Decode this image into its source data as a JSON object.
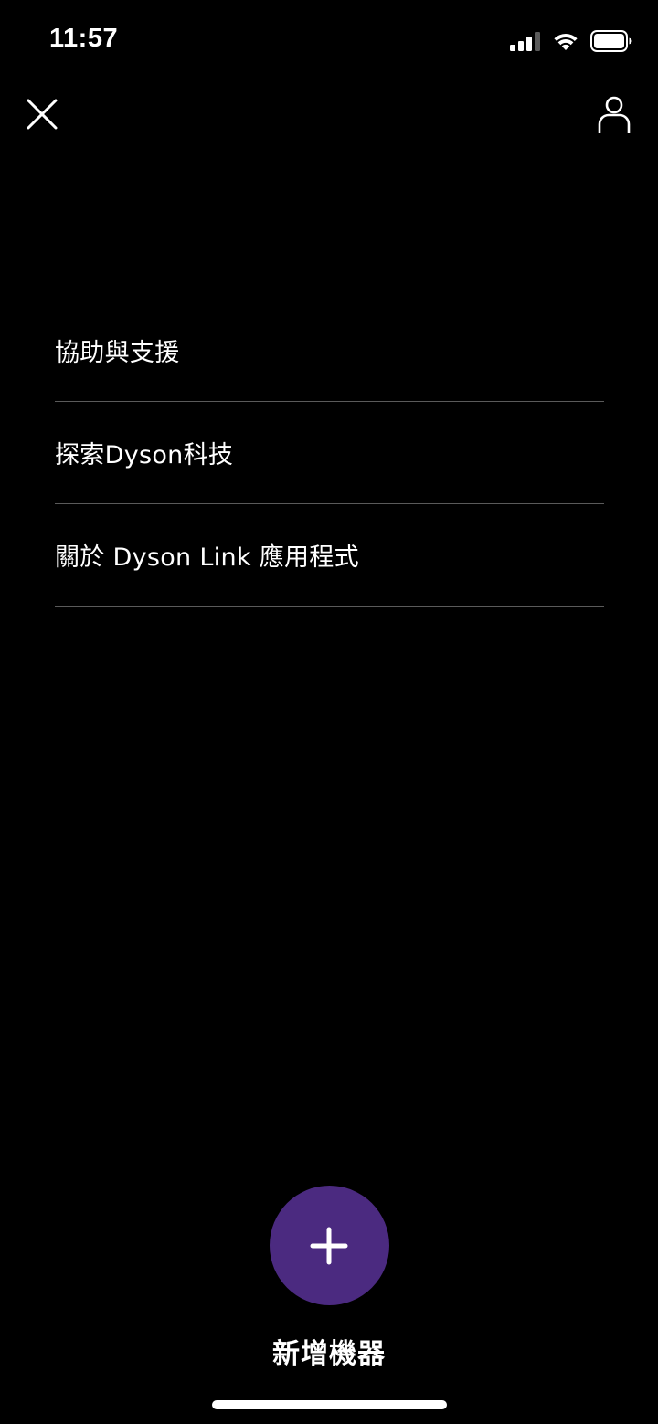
{
  "status_bar": {
    "time": "11:57",
    "signal_icon": "cellular-signal-icon",
    "wifi_icon": "wifi-icon",
    "battery_icon": "battery-icon"
  },
  "header": {
    "close_icon": "close-icon",
    "profile_icon": "person-icon"
  },
  "menu": {
    "items": [
      {
        "label": "協助與支援"
      },
      {
        "label": "探索Dyson科技"
      },
      {
        "label": "關於 Dyson Link 應用程式"
      }
    ]
  },
  "add_machine": {
    "icon": "plus-icon",
    "label": "新增機器"
  },
  "colors": {
    "background": "#000000",
    "accent": "#4b2a80",
    "divider": "#5a5a5a",
    "text": "#ffffff"
  }
}
